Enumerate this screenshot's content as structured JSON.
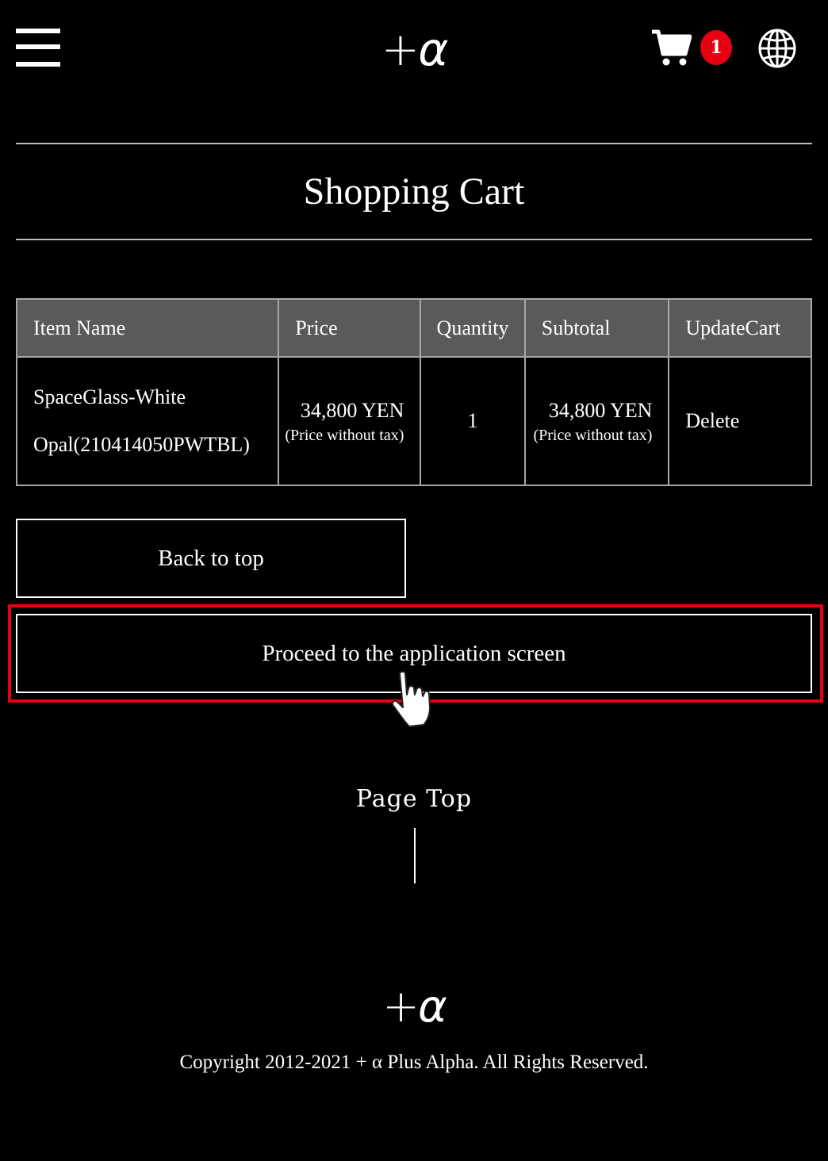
{
  "header": {
    "logo_plus": "+",
    "logo_alpha": "α",
    "cart_count": "1",
    "icons": {
      "menu": "hamburger-menu-icon",
      "cart": "shopping-cart-icon",
      "language": "globe-icon"
    }
  },
  "page": {
    "title": "Shopping Cart"
  },
  "cart_table": {
    "headers": [
      "Item Name",
      "Price",
      "Quantity",
      "Subtotal",
      "UpdateCart"
    ],
    "rows": [
      {
        "item_name_line1": "SpaceGlass-White",
        "item_name_line2": "Opal(210414050PWTBL)",
        "price": "34,800 YEN",
        "price_note": "(Price without tax)",
        "quantity": "1",
        "subtotal": "34,800 YEN",
        "subtotal_note": "(Price without tax)",
        "action": "Delete"
      }
    ]
  },
  "buttons": {
    "back_to_top": "Back to top",
    "proceed": "Proceed to the application screen"
  },
  "highlight_color": "#e60012",
  "footer": {
    "page_top": "Page Top",
    "logo_plus": "+",
    "logo_alpha": "α",
    "copyright": "Copyright 2012-2021 + α  Plus Alpha. All Rights Reserved."
  }
}
